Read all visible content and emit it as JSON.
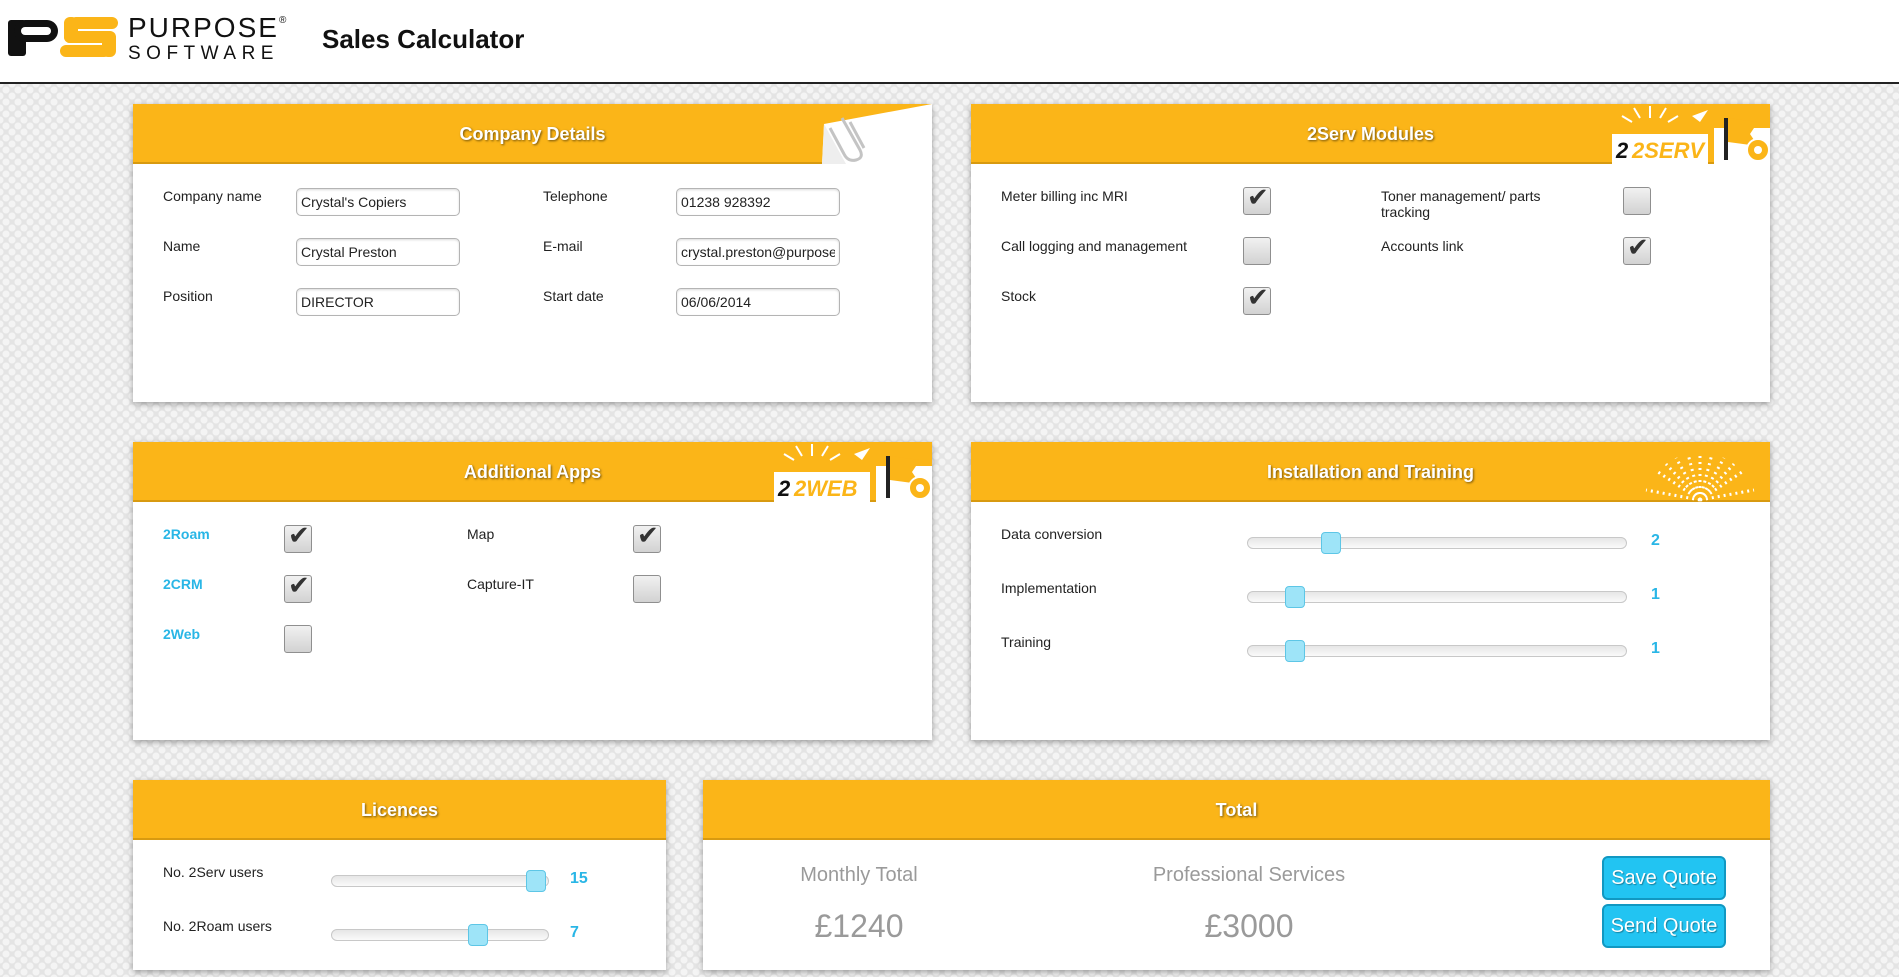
{
  "brand": {
    "logo_line1": "PURPOSE",
    "logo_reg": "®",
    "logo_line2": "SOFTWARE",
    "title": "Sales Calculator"
  },
  "company": {
    "title": "Company Details",
    "fields": {
      "company_name": {
        "label": "Company name",
        "value": "Crystal's Copiers"
      },
      "name": {
        "label": "Name",
        "value": "Crystal Preston"
      },
      "position": {
        "label": "Position",
        "value": "DIRECTOR"
      },
      "telephone": {
        "label": "Telephone",
        "value": "01238 928392"
      },
      "email": {
        "label": "E-mail",
        "value": "crystal.preston@purposesoftware.com"
      },
      "start_date": {
        "label": "Start date",
        "value": "06/06/2014"
      }
    }
  },
  "modules": {
    "title": "2Serv Modules",
    "badge": "2SERV",
    "items": [
      {
        "label": "Meter billing inc MRI",
        "checked": true
      },
      {
        "label": "Call logging and management",
        "checked": false
      },
      {
        "label": "Stock",
        "checked": true
      },
      {
        "label": "Toner management/ parts tracking",
        "checked": false
      },
      {
        "label": "Accounts link",
        "checked": true
      }
    ]
  },
  "apps": {
    "title": "Additional Apps",
    "badge": "2WEB",
    "items": [
      {
        "label": "2Roam",
        "checked": true
      },
      {
        "label": "2CRM",
        "checked": true
      },
      {
        "label": "2Web",
        "checked": false
      },
      {
        "label": "Map",
        "checked": true
      },
      {
        "label": "Capture-IT",
        "checked": false
      }
    ]
  },
  "install": {
    "title": "Installation and Training",
    "sliders": [
      {
        "label": "Data conversion",
        "value": 2,
        "max": 10
      },
      {
        "label": "Implementation",
        "value": 1,
        "max": 10
      },
      {
        "label": "Training",
        "value": 1,
        "max": 10
      }
    ]
  },
  "licences": {
    "title": "Licences",
    "sliders": [
      {
        "label": "No. 2Serv users",
        "value": 15,
        "max": 15
      },
      {
        "label": "No. 2Roam users",
        "value": 7,
        "max": 10
      }
    ]
  },
  "total": {
    "title": "Total",
    "monthly_label": "Monthly Total",
    "monthly_value": "£1240",
    "ps_label": "Professional Services",
    "ps_value": "£3000",
    "save_label": "Save Quote",
    "send_label": "Send Quote"
  },
  "colors": {
    "accent": "#fbb518",
    "link": "#29b6e6",
    "button": "#22c4f2"
  }
}
